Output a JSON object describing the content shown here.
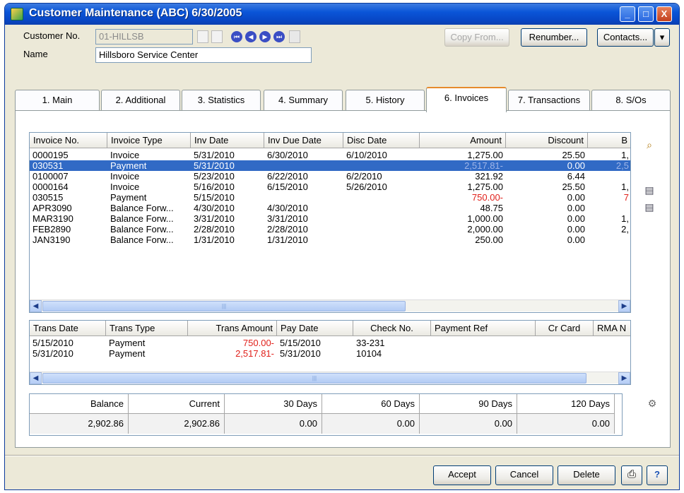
{
  "window": {
    "title": "Customer Maintenance (ABC) 6/30/2005",
    "min": "_",
    "max": "□",
    "close": "X"
  },
  "header": {
    "customer_no_label": "Customer No.",
    "customer_no": "01-HILLSB",
    "name_label": "Name",
    "name": "Hillsboro Service Center",
    "copy_from": "Copy From...",
    "renumber": "Renumber...",
    "contacts": "Contacts...",
    "dropdown": "▾"
  },
  "tabs": [
    {
      "label": "1. Main"
    },
    {
      "label": "2. Additional"
    },
    {
      "label": "3. Statistics"
    },
    {
      "label": "4. Summary"
    },
    {
      "label": "5. History"
    },
    {
      "label": "6. Invoices"
    },
    {
      "label": "7. Transactions"
    },
    {
      "label": "8. S/Os"
    }
  ],
  "invoices": {
    "columns": [
      "Invoice No.",
      "Invoice Type",
      "Inv Date",
      "Inv Due Date",
      "Disc Date",
      "Amount",
      "Discount",
      "B"
    ],
    "rows": [
      {
        "no": "0000195",
        "type": "Invoice",
        "date": "5/31/2010",
        "due": "6/30/2010",
        "disc_date": "6/10/2010",
        "amount": "1,275.00",
        "discount": "25.50",
        "b": "1,"
      },
      {
        "no": "030531",
        "type": "Payment",
        "date": "5/31/2010",
        "due": "",
        "disc_date": "",
        "amount": "2,517.81-",
        "discount": "0.00",
        "b": "2,5"
      },
      {
        "no": "0100007",
        "type": "Invoice",
        "date": "5/23/2010",
        "due": "6/22/2010",
        "disc_date": "6/2/2010",
        "amount": "321.92",
        "discount": "6.44",
        "b": ""
      },
      {
        "no": "0000164",
        "type": "Invoice",
        "date": "5/16/2010",
        "due": "6/15/2010",
        "disc_date": "5/26/2010",
        "amount": "1,275.00",
        "discount": "25.50",
        "b": "1,"
      },
      {
        "no": "030515",
        "type": "Payment",
        "date": "5/15/2010",
        "due": "",
        "disc_date": "",
        "amount": "750.00-",
        "discount": "0.00",
        "b": "7"
      },
      {
        "no": "APR3090",
        "type": "Balance Forw...",
        "date": "4/30/2010",
        "due": "4/30/2010",
        "disc_date": "",
        "amount": "48.75",
        "discount": "0.00",
        "b": ""
      },
      {
        "no": "MAR3190",
        "type": "Balance Forw...",
        "date": "3/31/2010",
        "due": "3/31/2010",
        "disc_date": "",
        "amount": "1,000.00",
        "discount": "0.00",
        "b": "1,"
      },
      {
        "no": "FEB2890",
        "type": "Balance Forw...",
        "date": "2/28/2010",
        "due": "2/28/2010",
        "disc_date": "",
        "amount": "2,000.00",
        "discount": "0.00",
        "b": "2,"
      },
      {
        "no": "JAN3190",
        "type": "Balance Forw...",
        "date": "1/31/2010",
        "due": "1/31/2010",
        "disc_date": "",
        "amount": "250.00",
        "discount": "0.00",
        "b": ""
      }
    ]
  },
  "transactions": {
    "columns": [
      "Trans Date",
      "Trans Type",
      "Trans Amount",
      "Pay Date",
      "Check No.",
      "Payment Ref",
      "Cr Card",
      "RMA N"
    ],
    "rows": [
      {
        "date": "5/15/2010",
        "type": "Payment",
        "amount": "750.00-",
        "pay_date": "5/15/2010",
        "check": "33-231"
      },
      {
        "date": "5/31/2010",
        "type": "Payment",
        "amount": "2,517.81-",
        "pay_date": "5/31/2010",
        "check": "10104"
      }
    ]
  },
  "aging": {
    "headers": [
      "Balance",
      "Current",
      "30 Days",
      "60 Days",
      "90 Days",
      "120 Days"
    ],
    "values": [
      "2,902.86",
      "2,902.86",
      "0.00",
      "0.00",
      "0.00",
      "0.00"
    ]
  },
  "footer": {
    "accept": "Accept",
    "cancel": "Cancel",
    "delete": "Delete"
  },
  "colors": {
    "title_bar": "#0a55d8",
    "selection": "#316ac5",
    "negative": "#e0201a",
    "active_tab": "#e68b2c"
  }
}
